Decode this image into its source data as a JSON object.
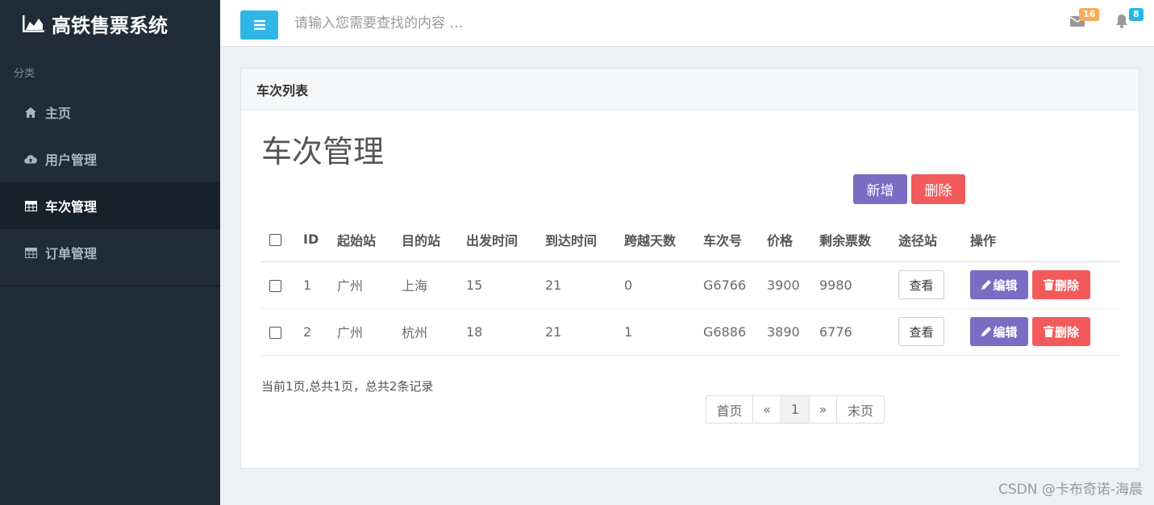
{
  "app": {
    "title": "高铁售票系统"
  },
  "sidebar": {
    "category_label": "分类",
    "items": [
      {
        "label": "主页",
        "icon": "home-icon",
        "active": false
      },
      {
        "label": "用户管理",
        "icon": "cloud-upload-icon",
        "active": false
      },
      {
        "label": "车次管理",
        "icon": "table-icon",
        "active": true
      },
      {
        "label": "订单管理",
        "icon": "table-icon",
        "active": false
      }
    ]
  },
  "topbar": {
    "search_placeholder": "请输入您需要查找的内容 …",
    "mail_count": "16",
    "notification_count": "8",
    "mail_badge_color": "#f8ac59",
    "bell_badge_color": "#23b7e5"
  },
  "panel": {
    "header": "车次列表",
    "title": "车次管理",
    "add_label": "新增",
    "delete_label": "删除"
  },
  "table": {
    "columns": [
      "ID",
      "起始站",
      "目的站",
      "出发时间",
      "到达时间",
      "跨越天数",
      "车次号",
      "价格",
      "剩余票数",
      "途径站",
      "操作"
    ],
    "rows": [
      {
        "id": "1",
        "from": "广州",
        "to": "上海",
        "depart": "15",
        "arrive": "21",
        "days": "0",
        "train_no": "G6766",
        "price": "3900",
        "remaining": "9980"
      },
      {
        "id": "2",
        "from": "广州",
        "to": "杭州",
        "depart": "18",
        "arrive": "21",
        "days": "1",
        "train_no": "G6886",
        "price": "3890",
        "remaining": "6776"
      }
    ],
    "view_label": "查看",
    "edit_label": "编辑",
    "row_delete_label": "删除"
  },
  "pagination": {
    "summary": "当前1页,总共1页，总共2条记录",
    "first": "首页",
    "prev": "«",
    "current": "1",
    "next": "»",
    "last": "末页"
  },
  "watermark": "CSDN @卡布奇诺-海晨",
  "colors": {
    "sidebar_bg": "#202c38",
    "accent_blue": "#2eb6e6",
    "purple": "#7b6cc4",
    "red": "#f25a5c"
  }
}
